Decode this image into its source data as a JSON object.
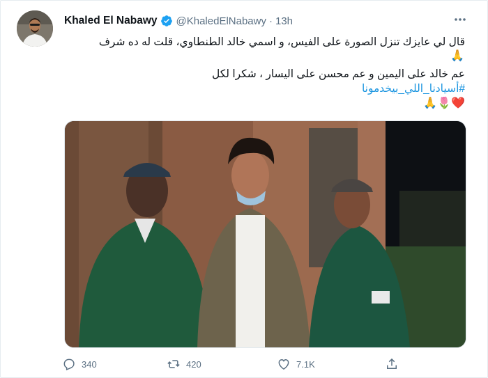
{
  "author": {
    "name": "Khaled El Nabawy",
    "handle": "@KhaledElNabawy",
    "separator": "·",
    "time": "13h"
  },
  "tweet": {
    "line1": "قال لي عايزك تنزل الصورة على الفيس، و اسمي خالد الطنطاوي، قلت له ده شرف",
    "line1_emoji": "🙏",
    "line2": "عم خالد على اليمين و عم محسن على اليسار ، شكرا لكل",
    "hashtag": "#أسيادنا_اللي_بيخدمونا",
    "line3_emoji": "🙏🌷❤️"
  },
  "actions": {
    "replies": "340",
    "retweets": "420",
    "likes": "7.1K"
  },
  "icons": {
    "verified": "verified-badge-icon",
    "more": "more-options-icon",
    "reply": "reply-icon",
    "retweet": "retweet-icon",
    "like": "heart-icon",
    "share": "share-icon"
  },
  "colors": {
    "accent": "#1da1f2",
    "hashtag": "#1b95e0",
    "secondary_text": "#5b7083",
    "primary_text": "#0f1419"
  }
}
